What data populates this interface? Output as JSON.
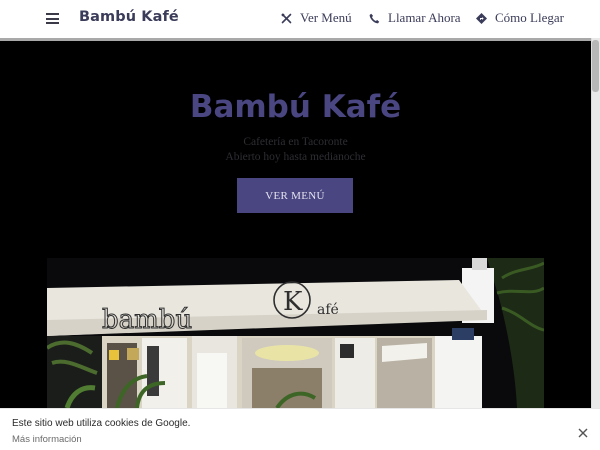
{
  "header": {
    "brand": "Bambú Kafé",
    "nav": [
      {
        "label": "Ver Menú",
        "icon": "cutlery-icon"
      },
      {
        "label": "Llamar Ahora",
        "icon": "phone-icon"
      },
      {
        "label": "Cómo Llegar",
        "icon": "directions-icon"
      }
    ]
  },
  "hero": {
    "title": "Bambú Kafé",
    "subtitle_line1": "Cafetería en Tacoronte",
    "subtitle_line2": "Abierto hoy hasta medianoche",
    "button_label": "VER MENÚ",
    "image": {
      "description_icon": "storefront-photo",
      "sign_text": "bambú Kafé"
    }
  },
  "cookie_banner": {
    "message": "Este sitio web utiliza cookies de Google.",
    "link": "Más información",
    "close_icon": "close-icon"
  },
  "colors": {
    "brand_text": "#3b3c59",
    "accent": "#4a4682",
    "hero_bg": "#000000",
    "button_text": "#e4e3ef"
  }
}
